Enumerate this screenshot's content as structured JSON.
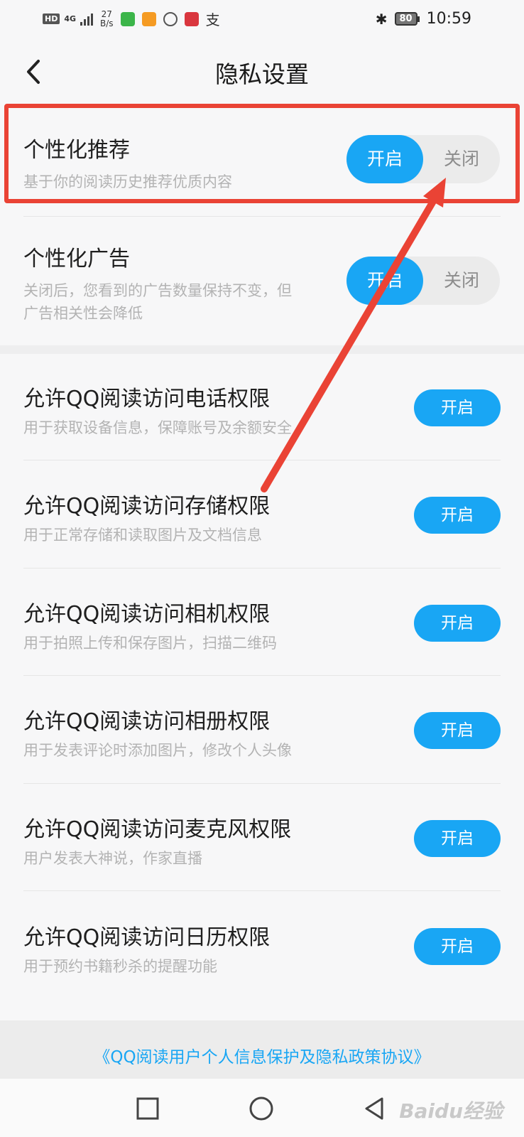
{
  "status_bar": {
    "hd": "HD",
    "signal": "4G",
    "speed_value": "27",
    "speed_unit": "B/s",
    "battery": "80",
    "time": "10:59"
  },
  "header": {
    "title": "隐私设置"
  },
  "personalized": [
    {
      "title": "个性化推荐",
      "desc_lines": [
        "基于你的阅读历史推荐优质内容"
      ],
      "on_label": "开启",
      "off_label": "关闭"
    },
    {
      "title": "个性化广告",
      "desc_lines": [
        "关闭后，您看到的广告数量保持不变，但",
        "广告相关性会降低"
      ],
      "on_label": "开启",
      "off_label": "关闭"
    }
  ],
  "permissions": [
    {
      "title": "允许QQ阅读访问电话权限",
      "desc": "用于获取设备信息，保障账号及余额安全",
      "button": "开启"
    },
    {
      "title": "允许QQ阅读访问存储权限",
      "desc": "用于正常存储和读取图片及文档信息",
      "button": "开启"
    },
    {
      "title": "允许QQ阅读访问相机权限",
      "desc": "用于拍照上传和保存图片，扫描二维码",
      "button": "开启"
    },
    {
      "title": "允许QQ阅读访问相册权限",
      "desc": "用于发表评论时添加图片，修改个人头像",
      "button": "开启"
    },
    {
      "title": "允许QQ阅读访问麦克风权限",
      "desc": "用户发表大神说，作家直播",
      "button": "开启"
    },
    {
      "title": "允许QQ阅读访问日历权限",
      "desc": "用于预约书籍秒杀的提醒功能",
      "button": "开启"
    }
  ],
  "footer": {
    "policy_link": "《QQ阅读用户个人信息保护及隐私政策协议》"
  },
  "watermark": "Baidu经验",
  "colors": {
    "accent": "#19a6f4",
    "annotation": "#ea4335"
  }
}
